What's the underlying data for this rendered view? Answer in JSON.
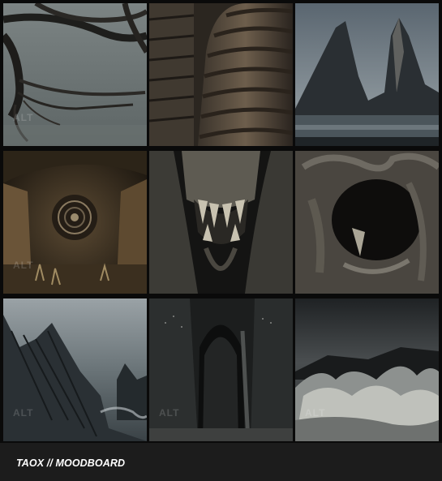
{
  "board": {
    "caption": "TAOX // MOODBOARD",
    "badge_text": "ALT",
    "images": [
      {
        "name": "driftwood-roots-image",
        "icon": "driftwood-icon"
      },
      {
        "name": "ribbed-spire-image",
        "icon": "spire-icon"
      },
      {
        "name": "twin-peaks-lake-image",
        "icon": "mountain-icon"
      },
      {
        "name": "ruined-cave-portal-image",
        "icon": "portal-icon"
      },
      {
        "name": "fanged-skull-image",
        "icon": "skull-icon"
      },
      {
        "name": "bone-cavern-image",
        "icon": "bone-cave-icon"
      },
      {
        "name": "jagged-coast-rocks-image",
        "icon": "rocks-icon"
      },
      {
        "name": "dark-cathedral-cave-image",
        "icon": "cathedral-icon"
      },
      {
        "name": "stormy-sea-waves-image",
        "icon": "waves-icon"
      }
    ]
  },
  "colors": {
    "background": "#0a0a0a",
    "caption_bar": "#1c1c1c",
    "caption_text": "#ffffff"
  }
}
